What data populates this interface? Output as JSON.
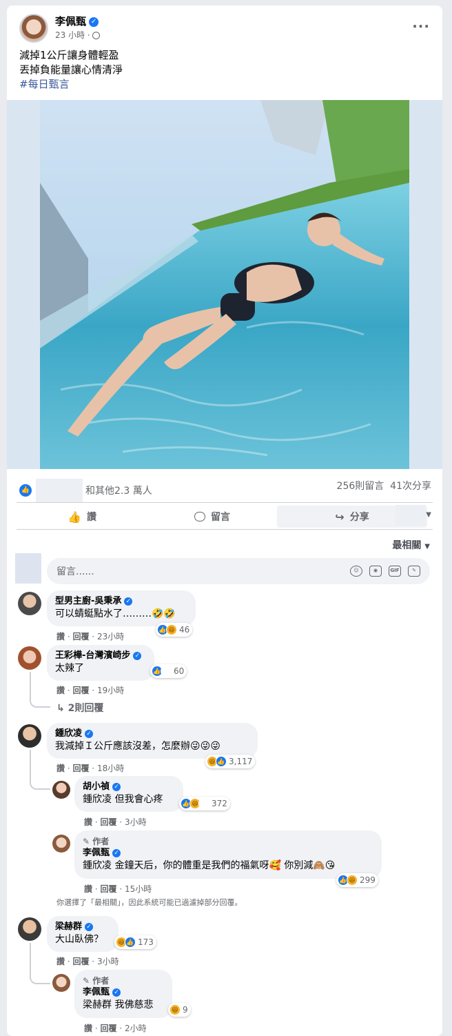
{
  "post": {
    "author": "李佩甄",
    "time": "23 小時",
    "text_line1": "減掉1公斤讓身體輕盈",
    "text_line2": "丟掉負能量讓心情清淨",
    "hashtag": "#每日甄言",
    "more_label": "···"
  },
  "reactions_summary": {
    "others": "和其他2.3 萬人",
    "comments": "256則留言",
    "shares": "41次分享"
  },
  "actions": {
    "like": "讚",
    "comment": "留言",
    "share": "分享"
  },
  "sort_label": "最相關",
  "comment_input": {
    "placeholder": "留言......"
  },
  "comments": [
    {
      "name": "型男主廚-吳秉承",
      "text": "可以蜻蜓點水了………🤣🤣",
      "like": "讚",
      "reply": "回覆",
      "time": "23小時",
      "reaction_count": "46"
    },
    {
      "name": "王彩樺-台灣濱崎步",
      "text": "太辣了",
      "like": "讚",
      "reply": "回覆",
      "time": "19小時",
      "reaction_count": "60",
      "replies_label": "2則回覆"
    },
    {
      "name": "鍾欣凌",
      "text": "我減掉Ｉ公斤應該沒差，怎麼辦😜😜😜",
      "like": "讚",
      "reply": "回覆",
      "time": "18小時",
      "reaction_count": "3,117"
    },
    {
      "name": "梁赫群",
      "text": "大山臥佛？",
      "like": "讚",
      "reply": "回覆",
      "time": "3小時",
      "reaction_count": "173"
    }
  ],
  "replies": [
    {
      "name": "胡小禎",
      "mention": "鍾欣凌",
      "text": "但我會心疼",
      "like": "讚",
      "reply": "回覆",
      "time": "3小時",
      "reaction_count": "372"
    },
    {
      "author_tag": "作者",
      "name": "李佩甄",
      "mention": "鍾欣凌",
      "text": "金鐘天后，你的體重是我們的福氣呀🥰 你別減🙈😘",
      "like": "讚",
      "reply": "回覆",
      "time": "15小時",
      "reaction_count": "299"
    },
    {
      "author_tag": "作者",
      "name": "李佩甄",
      "mention": "梁赫群",
      "text": "我佛慈悲",
      "like": "讚",
      "reply": "回覆",
      "time": "2小時",
      "reaction_count": "9"
    }
  ],
  "filter_note": "你選擇了「最相關」，因此系統可能已過濾掉部分回覆。",
  "colors": {
    "accent": "#1877f2",
    "link": "#385898",
    "bubble": "#f0f2f5"
  }
}
